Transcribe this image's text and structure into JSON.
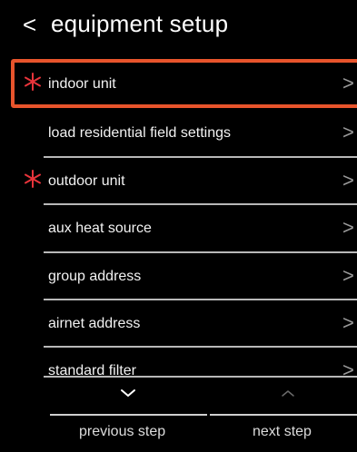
{
  "header": {
    "back_glyph": "<",
    "title": "equipment setup"
  },
  "rows": [
    {
      "label": "indoor unit",
      "required": true,
      "selected": true,
      "chevron": ">"
    },
    {
      "label": "load residential field settings",
      "required": false,
      "selected": false,
      "chevron": ">"
    },
    {
      "label": "outdoor unit",
      "required": true,
      "selected": false,
      "chevron": ">"
    },
    {
      "label": "aux heat source",
      "required": false,
      "selected": false,
      "chevron": ">"
    },
    {
      "label": "group address",
      "required": false,
      "selected": false,
      "chevron": ">"
    },
    {
      "label": "airnet address",
      "required": false,
      "selected": false,
      "chevron": ">"
    },
    {
      "label": "standard filter",
      "required": false,
      "selected": false,
      "chevron": ">"
    }
  ],
  "bottom_nav": {
    "previous_label": "previous step",
    "next_label": "next step",
    "previous_icon": "chevron-down-icon",
    "next_icon": "chevron-up-icon"
  },
  "colors": {
    "background": "#000000",
    "text": "#ffffff",
    "accent_selection": "#e8542c",
    "required_star": "#e8343b",
    "chevron": "#9a9a9a",
    "divider": "#b8b8b8"
  }
}
